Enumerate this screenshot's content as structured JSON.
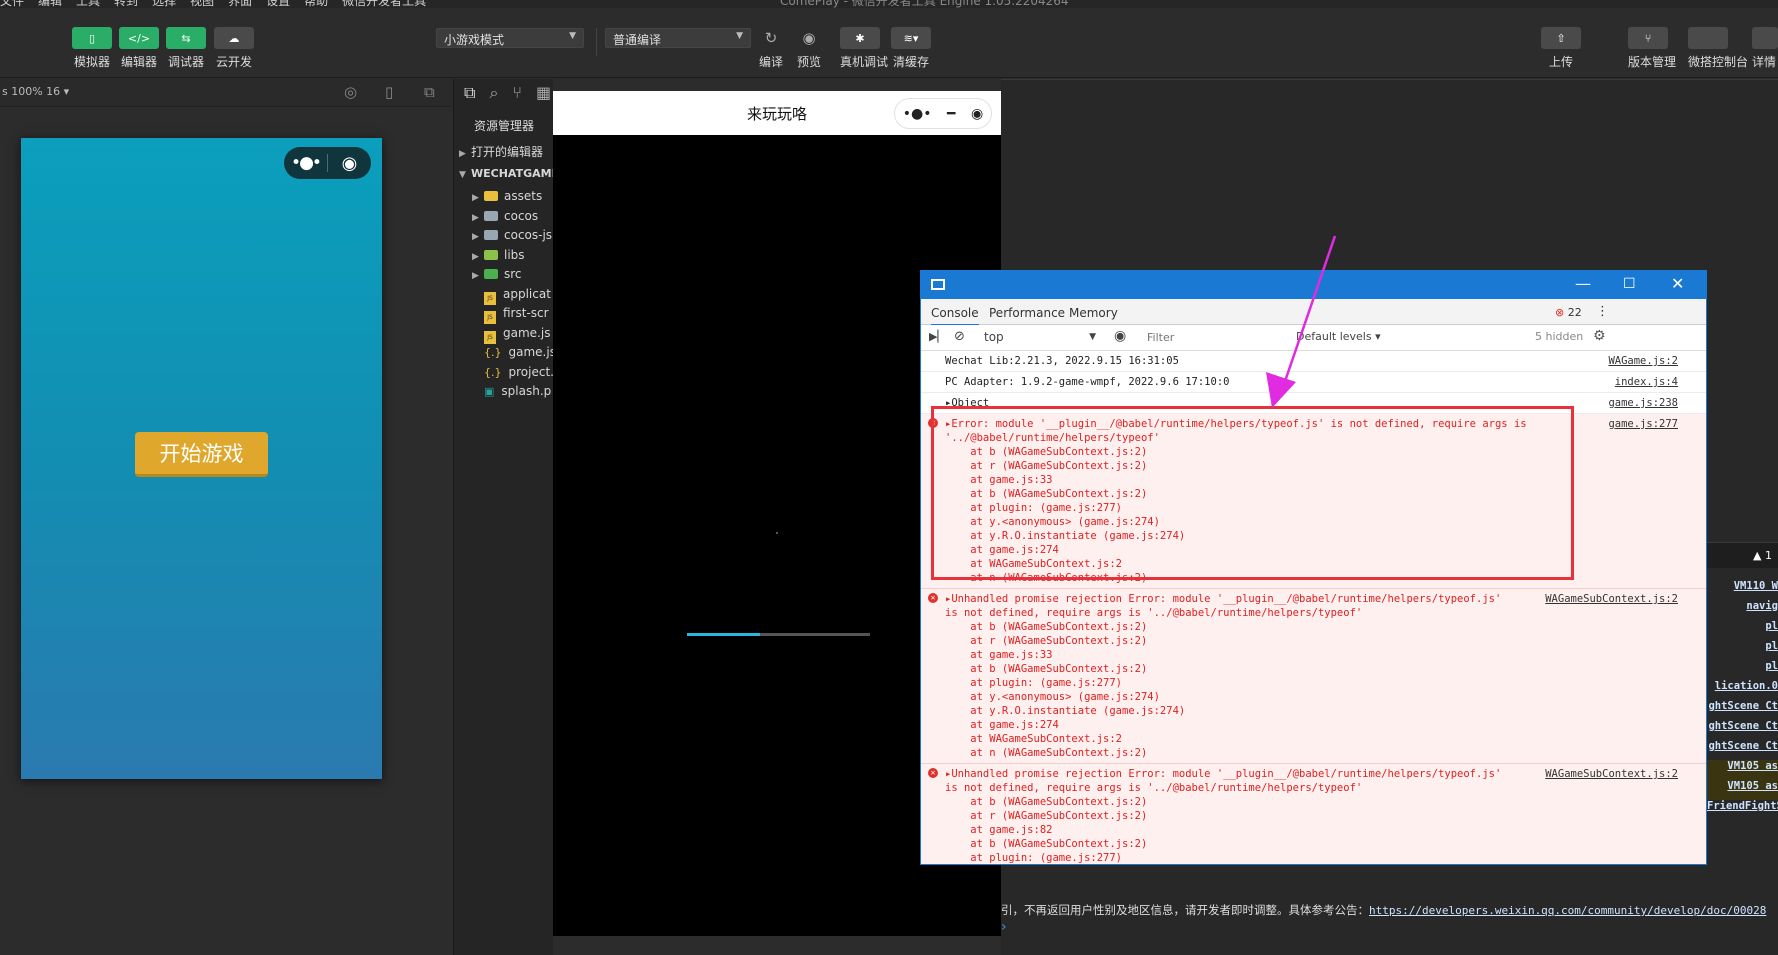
{
  "menubar": {
    "items": [
      "文件",
      "编辑",
      "工具",
      "转到",
      "选择",
      "视图",
      "界面",
      "设置",
      "帮助",
      "微信开发者工具"
    ],
    "window_title": "ComePlay - 微信开发者工具 Engine 1.05.2204264"
  },
  "toolbar": {
    "simulator": "模拟器",
    "editor": "编辑器",
    "debugger": "调试器",
    "cloud": "云开发",
    "mode_select": "小游戏模式",
    "compile_select": "普通编译",
    "compile": "编译",
    "preview": "预览",
    "remote_debug": "真机调试",
    "clear_cache": "清缓存",
    "upload": "上传",
    "version": "版本管理",
    "console": "微搭控制台",
    "details": "详情"
  },
  "simulator": {
    "zoom": "s 100% 16 ▾",
    "start_button": "开始游戏"
  },
  "explorer": {
    "title": "资源管理器",
    "open_editors": "打开的编辑器",
    "project": "WECHATGAME",
    "items": [
      {
        "name": "assets",
        "type": "folder"
      },
      {
        "name": "cocos",
        "type": "folder"
      },
      {
        "name": "cocos-js",
        "type": "folder"
      },
      {
        "name": "libs",
        "type": "folder"
      },
      {
        "name": "src",
        "type": "folder"
      },
      {
        "name": "applicat",
        "type": "js"
      },
      {
        "name": "first-scr",
        "type": "js"
      },
      {
        "name": "game.js",
        "type": "js"
      },
      {
        "name": "game.js",
        "type": "json"
      },
      {
        "name": "project.",
        "type": "json"
      },
      {
        "name": "splash.p",
        "type": "image"
      }
    ]
  },
  "game_window": {
    "title": "来玩玩咯",
    "progress": 0.4
  },
  "devtools": {
    "tabs": [
      "Console",
      "Performance",
      "Memory"
    ],
    "error_count": "22",
    "context": "top",
    "filter_placeholder": "Filter",
    "levels": "Default levels ▾",
    "hidden": "5 hidden",
    "lines": [
      {
        "text": "Wechat Lib:2.21.3, 2022.9.15 16:31:05",
        "src": "WAGame.js:2"
      },
      {
        "text": "PC Adapter: 1.9.2-game-wmpf, 2022.9.6 17:10:0",
        "src": "index.js:4"
      },
      {
        "text": "▸Object",
        "src": "game.js:238"
      }
    ],
    "errors": [
      {
        "msg": "▸Error: module '__plugin__/@babel/runtime/helpers/typeof.js' is not defined, require args is\n'../@babel/runtime/helpers/typeof'",
        "src": "game.js:277",
        "stack": "    at b (WAGameSubContext.js:2)\n    at r (WAGameSubContext.js:2)\n    at game.js:33\n    at b (WAGameSubContext.js:2)\n    at plugin: (game.js:277)\n    at y.<anonymous> (game.js:274)\n    at y.R.O.instantiate (game.js:274)\n    at game.js:274\n    at WAGameSubContext.js:2\n    at n (WAGameSubContext.js:2)"
      },
      {
        "msg": "▸Unhandled promise rejection Error: module '__plugin__/@babel/runtime/helpers/typeof.js'\nis not defined, require args is '../@babel/runtime/helpers/typeof'",
        "src": "WAGameSubContext.js:2",
        "stack": "    at b (WAGameSubContext.js:2)\n    at r (WAGameSubContext.js:2)\n    at game.js:33\n    at b (WAGameSubContext.js:2)\n    at plugin: (game.js:277)\n    at y.<anonymous> (game.js:274)\n    at y.R.O.instantiate (game.js:274)\n    at game.js:274\n    at WAGameSubContext.js:2\n    at n (WAGameSubContext.js:2)"
      },
      {
        "msg": "▸Unhandled promise rejection Error: module '__plugin__/@babel/runtime/helpers/typeof.js'\nis not defined, require args is '../@babel/runtime/helpers/typeof'",
        "src": "WAGameSubContext.js:2",
        "stack": "    at b (WAGameSubContext.js:2)\n    at r (WAGameSubContext.js:2)\n    at game.js:82\n    at b (WAGameSubContext.js:2)\n    at plugin: (game.js:277)"
      }
    ]
  },
  "right_panel": {
    "warn_count": "▲ 1",
    "links": [
      "VM110 W",
      "navig",
      "pl",
      "pl",
      "pl",
      "lication.0",
      "ghtScene Ct",
      "ghtScene Ct",
      "ghtScene Ct",
      "VM105 as",
      "VM105 as",
      "FriendFightScene Ct"
    ]
  },
  "notice": {
    "text": "引，不再返回用户性别及地区信息，请开发者即时调整。具体参考公告：",
    "link": "https://developers.weixin.qq.com/community/develop/doc/00028"
  },
  "colors": {
    "accent_green": "#2aae67",
    "devtools_blue": "#1979d3",
    "error_red": "#e02020",
    "start_button": "#dfa82c"
  }
}
